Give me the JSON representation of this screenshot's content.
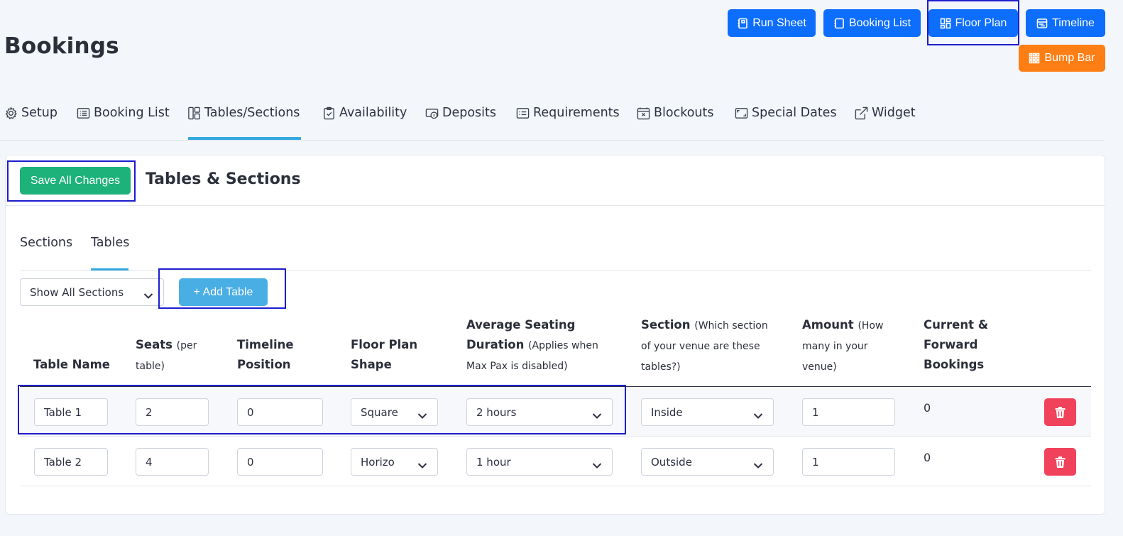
{
  "page": {
    "title": "Bookings"
  },
  "top_buttons": {
    "run_sheet": "Run Sheet",
    "booking_list": "Booking List",
    "floor_plan": "Floor Plan",
    "timeline": "Timeline",
    "bump_bar": "Bump Bar"
  },
  "tabs": [
    {
      "label": "Setup",
      "icon": "gear-icon"
    },
    {
      "label": "Booking List",
      "icon": "list-icon"
    },
    {
      "label": "Tables/Sections",
      "icon": "layout-icon",
      "active": true
    },
    {
      "label": "Availability",
      "icon": "clipboard-check-icon"
    },
    {
      "label": "Deposits",
      "icon": "deposit-icon"
    },
    {
      "label": "Requirements",
      "icon": "card-list-icon"
    },
    {
      "label": "Blockouts",
      "icon": "calendar-x-icon"
    },
    {
      "label": "Special Dates",
      "icon": "frame-icon"
    },
    {
      "label": "Widget",
      "icon": "external-link-icon"
    }
  ],
  "card": {
    "save_label": "Save All Changes",
    "title": "Tables & Sections",
    "subtabs": {
      "sections": "Sections",
      "tables": "Tables"
    },
    "filter_selected": "Show All Sections",
    "add_table_label": "+ Add Table"
  },
  "columns": {
    "table_name": "Table Name",
    "seats": "Seats",
    "seats_note": "(per table)",
    "timeline_position": "Timeline Position",
    "floor_plan_shape": "Floor Plan Shape",
    "avg_duration": "Average Seating Duration",
    "avg_duration_note": "(Applies when Max Pax is disabled)",
    "section": "Section",
    "section_note": "(Which section of your venue are these tables?)",
    "amount": "Amount",
    "amount_note": "(How many in your venue)",
    "current_bookings": "Current & Forward Bookings"
  },
  "rows": [
    {
      "name": "Table 1",
      "seats": "2",
      "timeline": "0",
      "shape": "Square",
      "duration": "2 hours",
      "section": "Inside",
      "amount": "1",
      "bookings": "0"
    },
    {
      "name": "Table 2",
      "seats": "4",
      "timeline": "0",
      "shape": "Horizo",
      "duration": "1 hour",
      "section": "Outside",
      "amount": "1",
      "bookings": "0"
    }
  ],
  "colors": {
    "primary": "#0d6efd",
    "orange": "#fd7e14",
    "success": "#1db27a",
    "info": "#49aee4",
    "danger": "#f1425b",
    "accent": "#33a9df"
  }
}
